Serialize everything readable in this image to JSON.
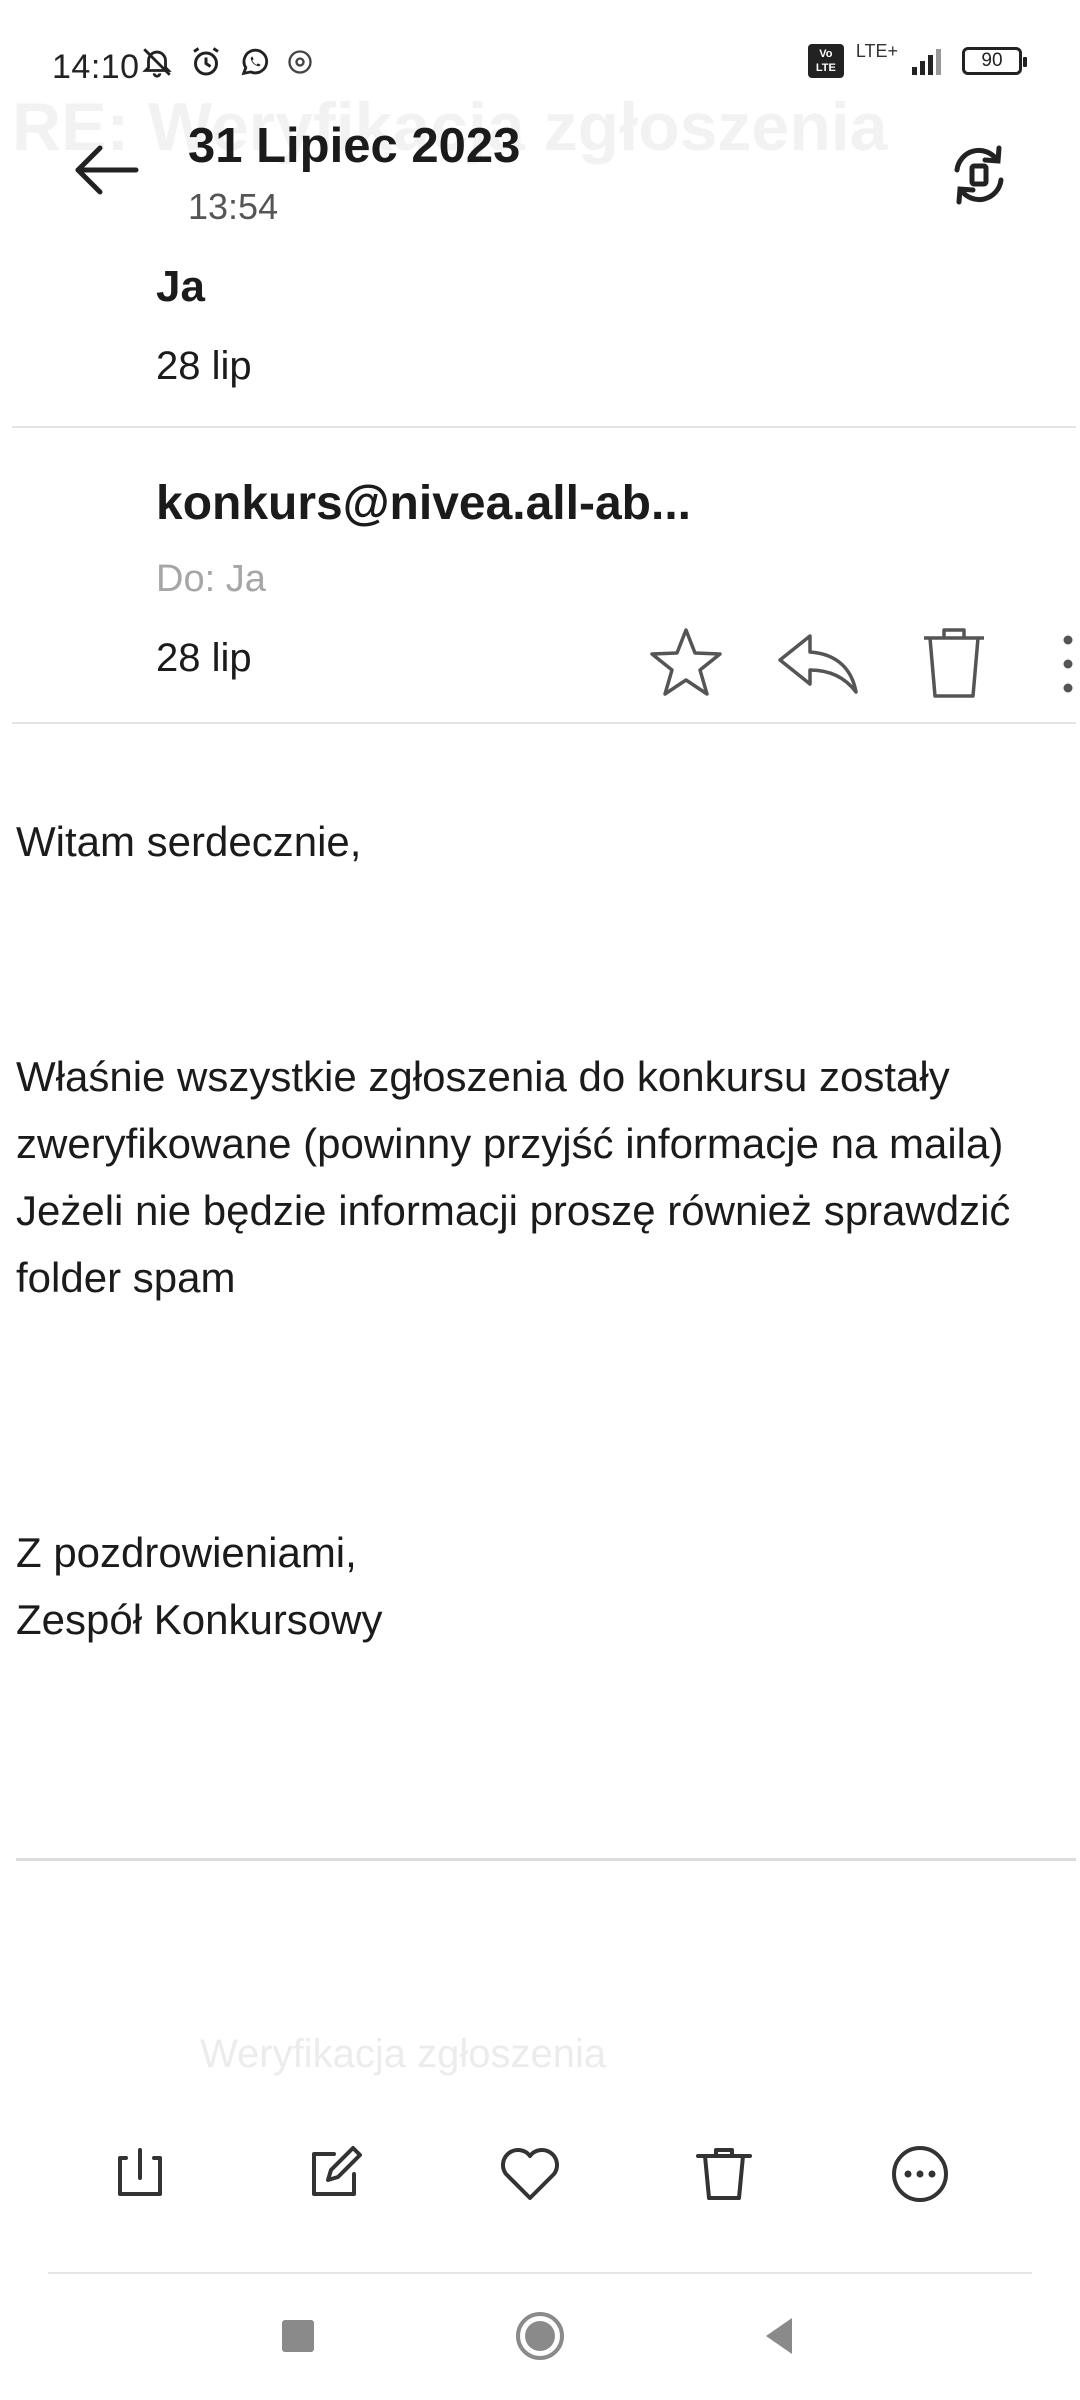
{
  "status_bar": {
    "time": "14:10",
    "network": "LTE+",
    "volte": "Vo LTE",
    "battery": "90"
  },
  "background_subject": "RE: Weryfikacja zgłoszenia",
  "header": {
    "date": "31 Lipiec 2023",
    "time": "13:54"
  },
  "thread": [
    {
      "sender": "Ja",
      "date": "28 lip"
    }
  ],
  "message": {
    "sender": "konkurs@nivea.all-ab...",
    "recipient": "Do: Ja",
    "date": "28 lip",
    "body": {
      "greeting": "Witam serdecznie,",
      "line1": "Właśnie wszystkie zgłoszenia do konkursu zostały zweryfikowane (powinny przyjść informacje na maila)",
      "line2": "Jeżeli nie będzie informacji proszę również sprawdzić folder spam",
      "closing1": "Z pozdrowieniami,",
      "closing2": "Zespół Konkursowy"
    }
  },
  "quoted_fragment": "Weryfikacja zgłoszenia",
  "toolbar": {
    "icons": [
      "archive-icon",
      "compose-icon",
      "heart-icon",
      "trash-icon",
      "more-icon"
    ]
  },
  "colors": {
    "text": "#1b1b1b",
    "muted": "#a6a6a6",
    "icon": "#333333",
    "divider": "#e3e3e3"
  }
}
